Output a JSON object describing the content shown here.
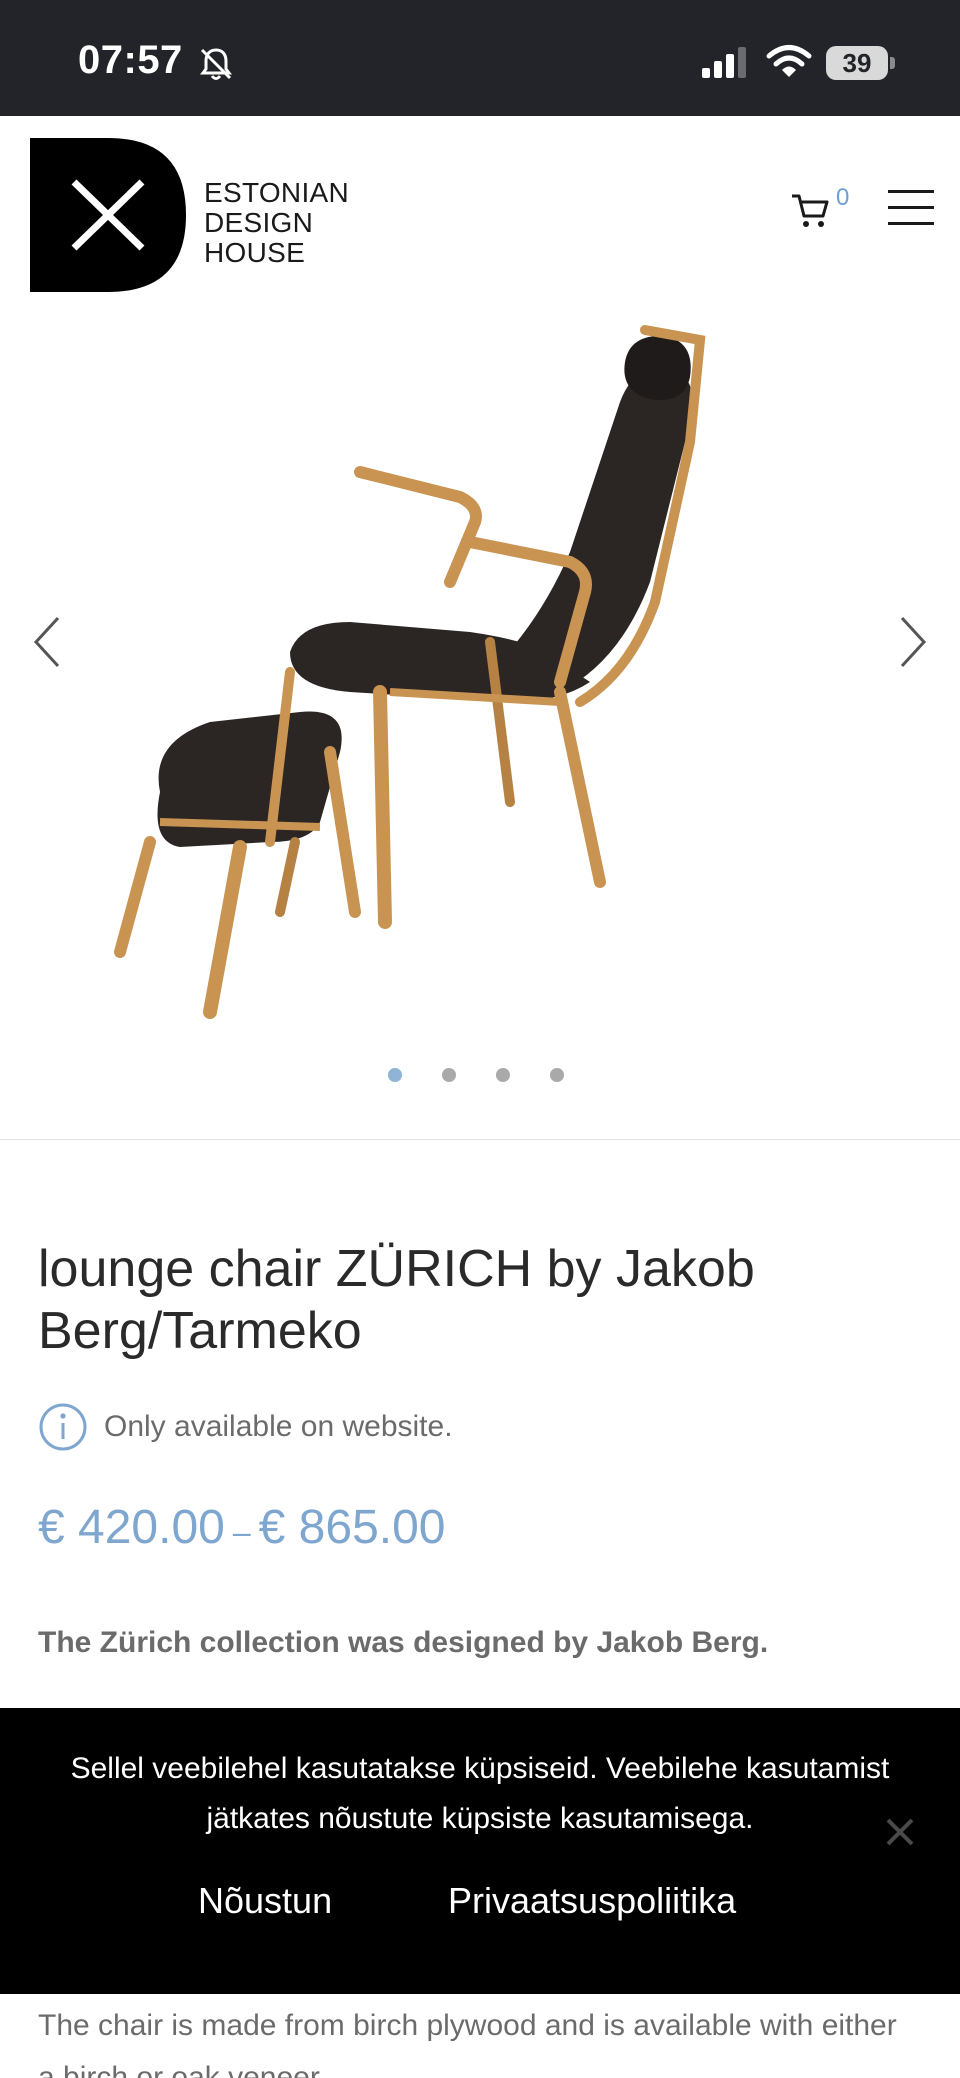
{
  "status_bar": {
    "time": "07:57",
    "battery": "39",
    "icons": [
      "bell-slash-icon",
      "cellular-signal-icon",
      "wifi-icon",
      "battery-icon"
    ]
  },
  "header": {
    "logo_lines": [
      "ESTONIAN",
      "DESIGN",
      "HOUSE"
    ],
    "cart_count": "0",
    "icons": [
      "logo-x-icon",
      "cart-icon",
      "hamburger-menu-icon"
    ]
  },
  "gallery": {
    "slide_count": 4,
    "active_slide": 1,
    "icons": [
      "chevron-left-icon",
      "chevron-right-icon"
    ]
  },
  "product": {
    "title": "lounge chair ZÜRICH by Jakob Berg/Tarmeko",
    "availability": "Only available on website.",
    "price_from": "€ 420.00",
    "price_separator": "–",
    "price_to": "€ 865.00",
    "description": "The Zürich collection was designed by Jakob Berg.",
    "description_2": "The chair is made from birch plywood and is available with either a birch or oak veneer."
  },
  "cookie_banner": {
    "text": "Sellel veebilehel kasutatakse küpsiseid. Veebilehe kasutamist jätkates nõustute küpsiste kasutamisega.",
    "accept_label": "Nõustun",
    "privacy_label": "Privaatsuspoliitika"
  },
  "colors": {
    "accent": "#7ea6cf",
    "status_bar_bg": "#23232a",
    "banner_bg": "#000000",
    "text_muted": "#6b6b6b"
  }
}
